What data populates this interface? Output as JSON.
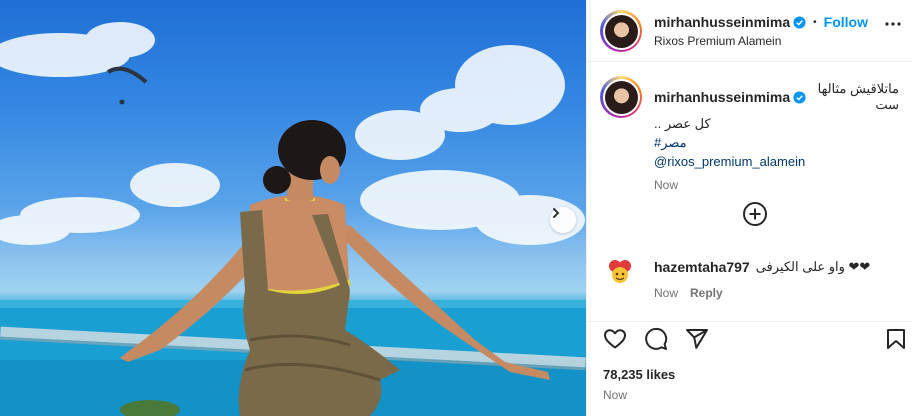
{
  "post": {
    "username": "mirhanhusseinmima",
    "follow_label": "Follow",
    "separator": "•",
    "location": "Rixos Premium Alamein",
    "caption_line1": "ماتلاقيش مثالها ست",
    "caption_line2": "كل عصر ..",
    "hashtag": "#مصر",
    "mention": "@rixos_premium_alamein",
    "caption_time": "Now",
    "likes": "78,235 likes",
    "post_time": "Now"
  },
  "comment": {
    "username": "hazemtaha797",
    "text": "واو على الكيرفى ❤❤",
    "time": "Now",
    "reply_label": "Reply"
  },
  "icons": {
    "verified": "verified-badge-icon",
    "more": "more-options-icon",
    "load_more": "plus-circle-icon",
    "next": "chevron-right-icon",
    "like": "heart-icon",
    "comment": "comment-icon",
    "share": "share-icon",
    "save": "bookmark-icon"
  },
  "colors": {
    "link_blue": "#0095f6",
    "hashtag": "#00376b",
    "secondary_text": "#737373"
  }
}
